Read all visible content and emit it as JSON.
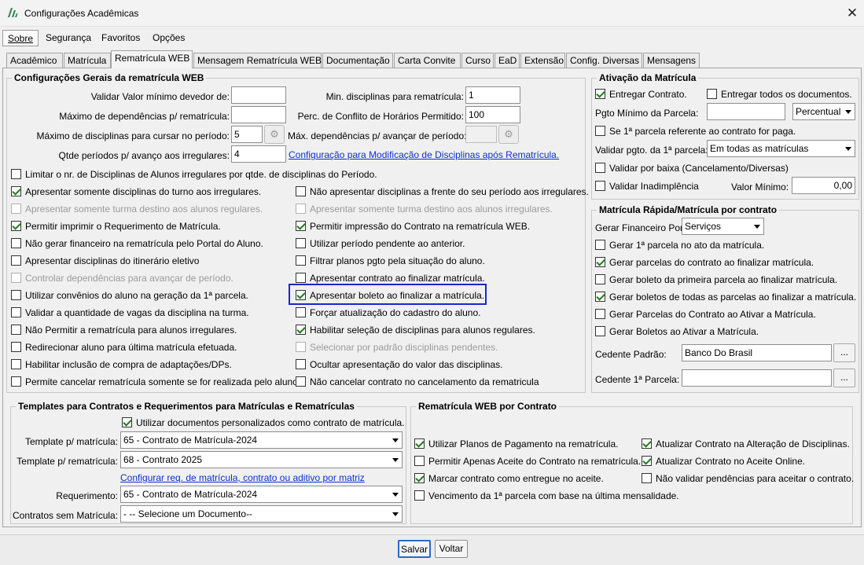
{
  "window": {
    "title": "Configurações Acadêmicas",
    "close_glyph": "✕",
    "app_icon": "app-logo-icon"
  },
  "menu": [
    "Sobre",
    "Segurança",
    "Favoritos",
    "Opções"
  ],
  "tabs": [
    "Acadêmico",
    "Matrícula",
    "Rematrícula WEB",
    "Mensagem Rematrícula WEB",
    "Documentação",
    "Carta Convite",
    "Curso",
    "EaD",
    "Extensão",
    "Config. Diversas",
    "Mensagens"
  ],
  "general": {
    "title": "Configurações Gerais da rematrícula WEB",
    "fields": {
      "valor_minimo_label": "Validar Valor mínimo devedor de:",
      "valor_minimo_value": "",
      "max_dependencias_label": "Máximo de dependências p/ rematrícula:",
      "max_dependencias_value": "",
      "max_disciplinas_label": "Máximo de disciplinas para cursar no período:",
      "max_disciplinas_value": "5",
      "qtde_periodos_label": "Qtde períodos p/ avanço aos irregulares:",
      "qtde_periodos_value": "4",
      "min_disciplinas_label": "Min. disciplinas para rematrícula:",
      "min_disciplinas_value": "1",
      "perc_conflito_label": "Perc. de Conflito de Horários Permitido:",
      "perc_conflito_value": "100",
      "max_dep_avancar_label": "Máx. dependências p/ avançar de período:",
      "max_dep_avancar_value": "",
      "config_link": "Configuração para Modificação de Disciplinas após Rematrícula."
    },
    "limit_checkbox": "Limitar o nr. de Disciplinas de Alunos irregulares por qtde. de disciplinas do Período.",
    "left_checks": [
      {
        "label": "Apresentar somente disciplinas do turno aos irregulares.",
        "checked": true,
        "disabled": false
      },
      {
        "label": "Apresentar somente turma destino aos alunos regulares.",
        "checked": false,
        "disabled": true
      },
      {
        "label": "Permitir imprimir o Requerimento de Matrícula.",
        "checked": true,
        "disabled": false
      },
      {
        "label": "Não gerar financeiro na rematrícula pelo Portal do Aluno.",
        "checked": false,
        "disabled": false
      },
      {
        "label": "Apresentar disciplinas do itinerário eletivo",
        "checked": false,
        "disabled": false
      },
      {
        "label": "Controlar dependências para avançar de período.",
        "checked": false,
        "disabled": true
      },
      {
        "label": "Utilizar convênios do aluno na geração da 1ª parcela.",
        "checked": false,
        "disabled": false
      },
      {
        "label": "Validar a quantidade de vagas da disciplina na turma.",
        "checked": false,
        "disabled": false
      },
      {
        "label": "Não Permitir a rematrícula para alunos irregulares.",
        "checked": false,
        "disabled": false
      },
      {
        "label": "Redirecionar aluno para última matrícula efetuada.",
        "checked": false,
        "disabled": false
      },
      {
        "label": "Habilitar inclusão de compra de adaptações/DPs.",
        "checked": false,
        "disabled": false
      },
      {
        "label": "Permite cancelar rematrícula somente se for realizada pelo aluno.",
        "checked": false,
        "disabled": false
      }
    ],
    "right_checks": [
      {
        "label": "Não apresentar disciplinas a frente do seu período aos irregulares.",
        "checked": false,
        "disabled": false
      },
      {
        "label": "Apresentar somente turma destino aos alunos irregulares.",
        "checked": false,
        "disabled": true
      },
      {
        "label": "Permitir impressão do Contrato na rematrícula WEB.",
        "checked": true,
        "disabled": false
      },
      {
        "label": "Utilizar período pendente ao anterior.",
        "checked": false,
        "disabled": false
      },
      {
        "label": "Filtrar planos pgto pela situação do aluno.",
        "checked": false,
        "disabled": false
      },
      {
        "label": "Apresentar contrato ao finalizar matrícula.",
        "checked": false,
        "disabled": false
      },
      {
        "label": "Apresentar boleto ao finalizar a matrícula.",
        "checked": true,
        "disabled": false
      },
      {
        "label": "Forçar atualização do cadastro do aluno.",
        "checked": false,
        "disabled": false
      },
      {
        "label": "Habilitar seleção de disciplinas para alunos regulares.",
        "checked": true,
        "disabled": false
      },
      {
        "label": "Selecionar por padrão disciplinas pendentes.",
        "checked": false,
        "disabled": true
      },
      {
        "label": "Ocultar apresentação do valor das disciplinas.",
        "checked": false,
        "disabled": false
      },
      {
        "label": "Não cancelar contrato no cancelamento da rematricula",
        "checked": false,
        "disabled": false
      }
    ]
  },
  "ativacao": {
    "title": "Ativação da Matrícula",
    "entregar_contrato": "Entregar Contrato.",
    "entregar_todos": "Entregar todos os documentos.",
    "pgto_minimo_label": "Pgto Mínimo da Parcela:",
    "pgto_minimo_value": "",
    "pgto_minimo_type": "Percentual",
    "se_primeira": "Se 1ª parcela referente ao contrato for paga.",
    "validar_pgto_label": "Validar pgto. da 1ª parcela:",
    "validar_pgto_value": "Em todas as matrículas",
    "validar_baixa": "Validar por baixa (Cancelamento/Diversas)",
    "validar_inadimplencia": "Validar Inadimplência",
    "valor_minimo_label": "Valor Mínimo:",
    "valor_minimo_value": "0,00"
  },
  "rapida": {
    "title": "Matrícula Rápida/Matrícula por contrato",
    "gerar_label": "Gerar Financeiro Por:",
    "gerar_value": "Serviços",
    "checks": [
      {
        "label": "Gerar 1ª parcela no ato da matrícula.",
        "checked": false
      },
      {
        "label": "Gerar parcelas do contrato ao finalizar matrícula.",
        "checked": true
      },
      {
        "label": "Gerar boleto da primeira parcela ao finalizar matrícula.",
        "checked": false
      },
      {
        "label": "Gerar boletos de todas as parcelas ao finalizar a matrícula.",
        "checked": true
      },
      {
        "label": "Gerar Parcelas do Contrato ao Ativar a Matrícula.",
        "checked": false
      },
      {
        "label": "Gerar Boletos ao Ativar a Matrícula.",
        "checked": false
      }
    ],
    "cedente_label": "Cedente Padrão:",
    "cedente_value": "Banco Do Brasil",
    "cedente1_label": "Cedente 1ª Parcela:",
    "cedente1_value": "",
    "dots": "..."
  },
  "templates": {
    "title": "Templates para Contratos e Requerimentos para Matrículas e Rematrículas",
    "utilizar": "Utilizar documentos personalizados como contrato de matrícula.",
    "tpl_matricula_label": "Template p/ matrícula:",
    "tpl_matricula_value": "65 - Contrato de Matrícula-2024",
    "tpl_rematricula_label": "Template p/ rematrícula:",
    "tpl_rematricula_value": "68 - Contrato 2025",
    "config_link": "Configurar req. de matrícula, contrato ou aditivo por matriz",
    "requerimento_label": "Requerimento:",
    "requerimento_value": "65 - Contrato de Matrícula-2024",
    "sem_matricula_label": "Contratos sem Matrícula:",
    "sem_matricula_value": "- -- Selecione um Documento--"
  },
  "contrato": {
    "title": "Rematrícula WEB por Contrato",
    "checks_left": [
      {
        "label": "Utilizar Planos de Pagamento na rematrícula.",
        "checked": true
      },
      {
        "label": "Permitir Apenas Aceite do Contrato na rematrícula.",
        "checked": false
      },
      {
        "label": "Marcar contrato como entregue no aceite.",
        "checked": true
      },
      {
        "label": "Vencimento da 1ª parcela com base na última mensalidade.",
        "checked": false
      }
    ],
    "checks_right": [
      {
        "label": "Atualizar Contrato na Alteração de Disciplinas.",
        "checked": true
      },
      {
        "label": "Atualizar Contrato no Aceite Online.",
        "checked": true
      },
      {
        "label": "Não validar pendências para aceitar o contrato.",
        "checked": false
      }
    ]
  },
  "buttons": {
    "save": "Salvar",
    "back": "Voltar"
  },
  "colors": {
    "focus": "#1b27c9",
    "link": "#0b2fd4",
    "check": "#1f7a1f"
  }
}
